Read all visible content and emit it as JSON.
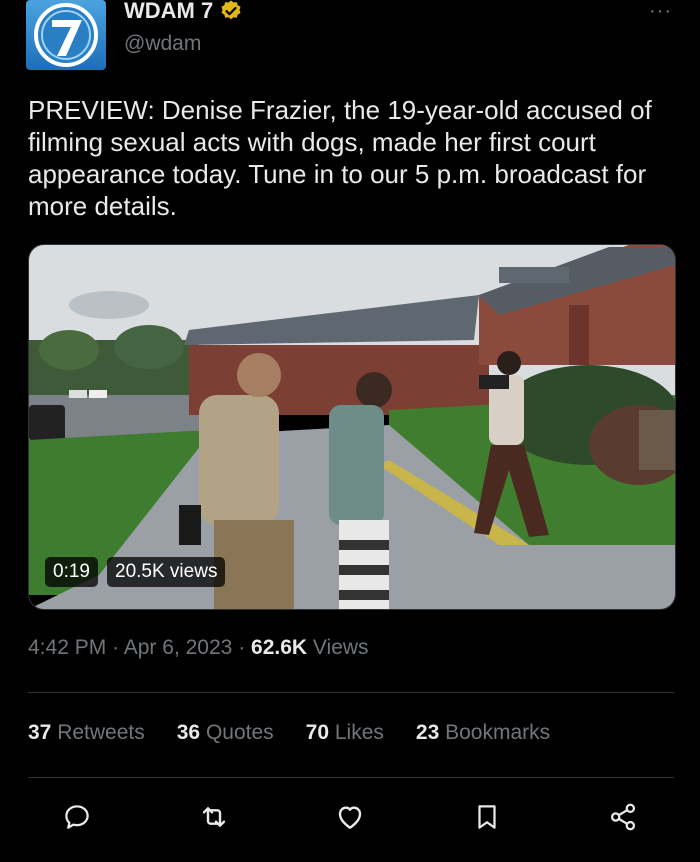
{
  "header": {
    "account_name": "WDAM 7",
    "handle": "@wdam",
    "more_label": "···",
    "logo_numeral": "7"
  },
  "tweet": {
    "text": "PREVIEW: Denise Frazier, the 19-year-old accused of filming sexual acts with dogs, made her first court appearance today. Tune in to our 5 p.m. broadcast for more details."
  },
  "video": {
    "duration": "0:19",
    "views": "20.5K views"
  },
  "meta": {
    "time": "4:42 PM",
    "separator": "·",
    "date": "Apr 6, 2023",
    "view_count": "62.6K",
    "view_label": "Views"
  },
  "stats": [
    {
      "count": "37",
      "label": "Retweets"
    },
    {
      "count": "36",
      "label": "Quotes"
    },
    {
      "count": "70",
      "label": "Likes"
    },
    {
      "count": "23",
      "label": "Bookmarks"
    }
  ],
  "colors": {
    "background": "#000000",
    "text_primary": "#e7e9ea",
    "text_secondary": "#71767b",
    "verified_badge": "#e2b719",
    "divider": "#2f3336"
  },
  "icons": {
    "reply": "reply-icon",
    "retweet": "retweet-icon",
    "like": "like-icon",
    "bookmark": "bookmark-icon",
    "share": "share-icon"
  }
}
